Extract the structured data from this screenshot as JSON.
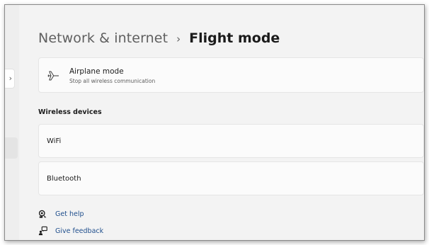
{
  "breadcrumb": {
    "parent": "Network & internet",
    "separator": "›",
    "current": "Flight mode"
  },
  "airplane_mode": {
    "title": "Airplane mode",
    "description": "Stop all wireless communication"
  },
  "wireless_devices": {
    "heading": "Wireless devices",
    "items": [
      {
        "label": "WiFi"
      },
      {
        "label": "Bluetooth"
      }
    ]
  },
  "links": {
    "get_help": "Get help",
    "give_feedback": "Give feedback"
  },
  "icons": {
    "airplane": "airplane-icon",
    "help": "get-help-icon",
    "feedback": "give-feedback-icon"
  },
  "colors": {
    "link": "#1f4e8c",
    "window_bg": "#f3f3f3",
    "card_bg": "#fbfbfb"
  }
}
